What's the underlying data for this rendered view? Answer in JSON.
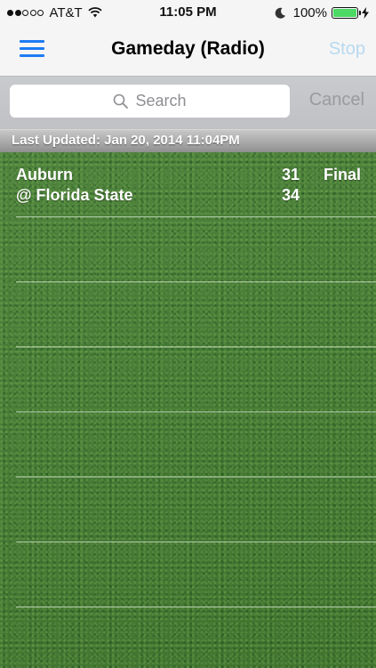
{
  "status_bar": {
    "carrier": "AT&T",
    "time": "11:05 PM",
    "battery_percent": "100%",
    "battery_level": 1.0,
    "signal_bars_filled": 2,
    "signal_bars_total": 5,
    "icons": [
      "wifi-icon",
      "moon-icon",
      "battery-icon",
      "bolt-icon"
    ]
  },
  "nav": {
    "title": "Gameday (Radio)",
    "stop_label": "Stop",
    "menu_icon": "menu-icon",
    "accent_color": "#1d7bf4",
    "stop_color": "#b7d9ef"
  },
  "search": {
    "placeholder": "Search",
    "cancel_label": "Cancel",
    "icon": "search-icon"
  },
  "updated": {
    "text": "Last Updated: Jan 20, 2014 11:04PM"
  },
  "games": [
    {
      "away_team": "Auburn",
      "home_team": "@ Florida State",
      "away_score": "31",
      "home_score": "34",
      "status": "Final"
    }
  ]
}
